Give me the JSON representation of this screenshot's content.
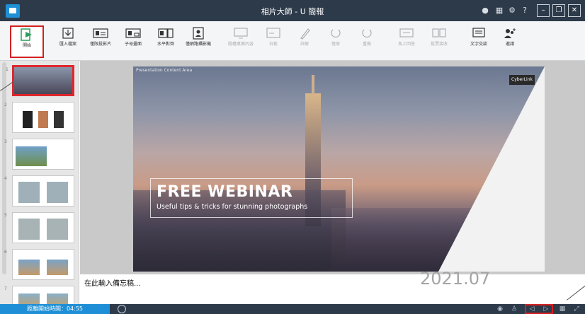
{
  "window": {
    "title": "相片大師 - U 簡報"
  },
  "ribbon": {
    "buttons": [
      {
        "label": "開始",
        "enabled": true
      },
      {
        "label": "匯入檔案",
        "enabled": true
      },
      {
        "label": "僅限投影片",
        "enabled": true
      },
      {
        "label": "子母畫面",
        "enabled": true
      },
      {
        "label": "水平對齊",
        "enabled": true
      },
      {
        "label": "僅網路攝影機",
        "enabled": true
      },
      {
        "label": "隨權桌面內容",
        "enabled": false
      },
      {
        "label": "白板",
        "enabled": false
      },
      {
        "label": "註解",
        "enabled": false
      },
      {
        "label": "復原",
        "enabled": false
      },
      {
        "label": "重做",
        "enabled": false
      },
      {
        "label": "馬上回答",
        "enabled": false
      },
      {
        "label": "投票接收",
        "enabled": false
      },
      {
        "label": "文字交談",
        "enabled": true
      },
      {
        "label": "邀請",
        "enabled": true
      }
    ]
  },
  "slides": {
    "count": 8,
    "selected": 1
  },
  "slide": {
    "content_label": "Presentation Content Area",
    "brand": "CyberLink",
    "headline": "FREE WEBINAR",
    "subtitle": "Useful tips & tricks for stunning photographs"
  },
  "notes": {
    "placeholder": "在此輸入備忘稿...",
    "watermark": "2021.07"
  },
  "status": {
    "timer": "距離開始時間：04:55"
  }
}
